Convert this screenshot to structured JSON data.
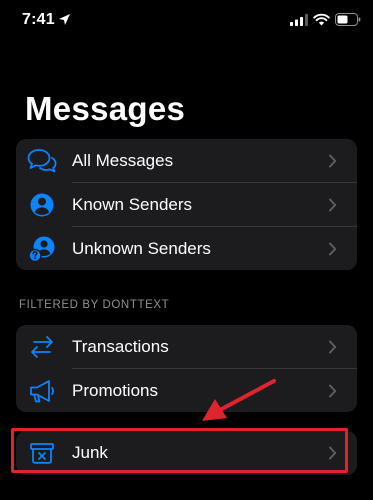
{
  "status_bar": {
    "time": "7:41"
  },
  "page_title": "Messages",
  "group_main": {
    "items": [
      {
        "label": "All Messages",
        "icon": "speech-bubbles-icon"
      },
      {
        "label": "Known Senders",
        "icon": "person-circle-icon"
      },
      {
        "label": "Unknown Senders",
        "icon": "person-question-icon"
      }
    ]
  },
  "filtered_section": {
    "header": "FILTERED BY DONTTEXT",
    "items": [
      {
        "label": "Transactions",
        "icon": "arrows-left-right-icon"
      },
      {
        "label": "Promotions",
        "icon": "megaphone-icon"
      }
    ]
  },
  "junk": {
    "label": "Junk",
    "icon": "junk-bin-icon"
  },
  "colors": {
    "accent": "#0a84ff",
    "annotation": "#e0242e",
    "cell": "#1c1c1e",
    "background": "#000000"
  }
}
